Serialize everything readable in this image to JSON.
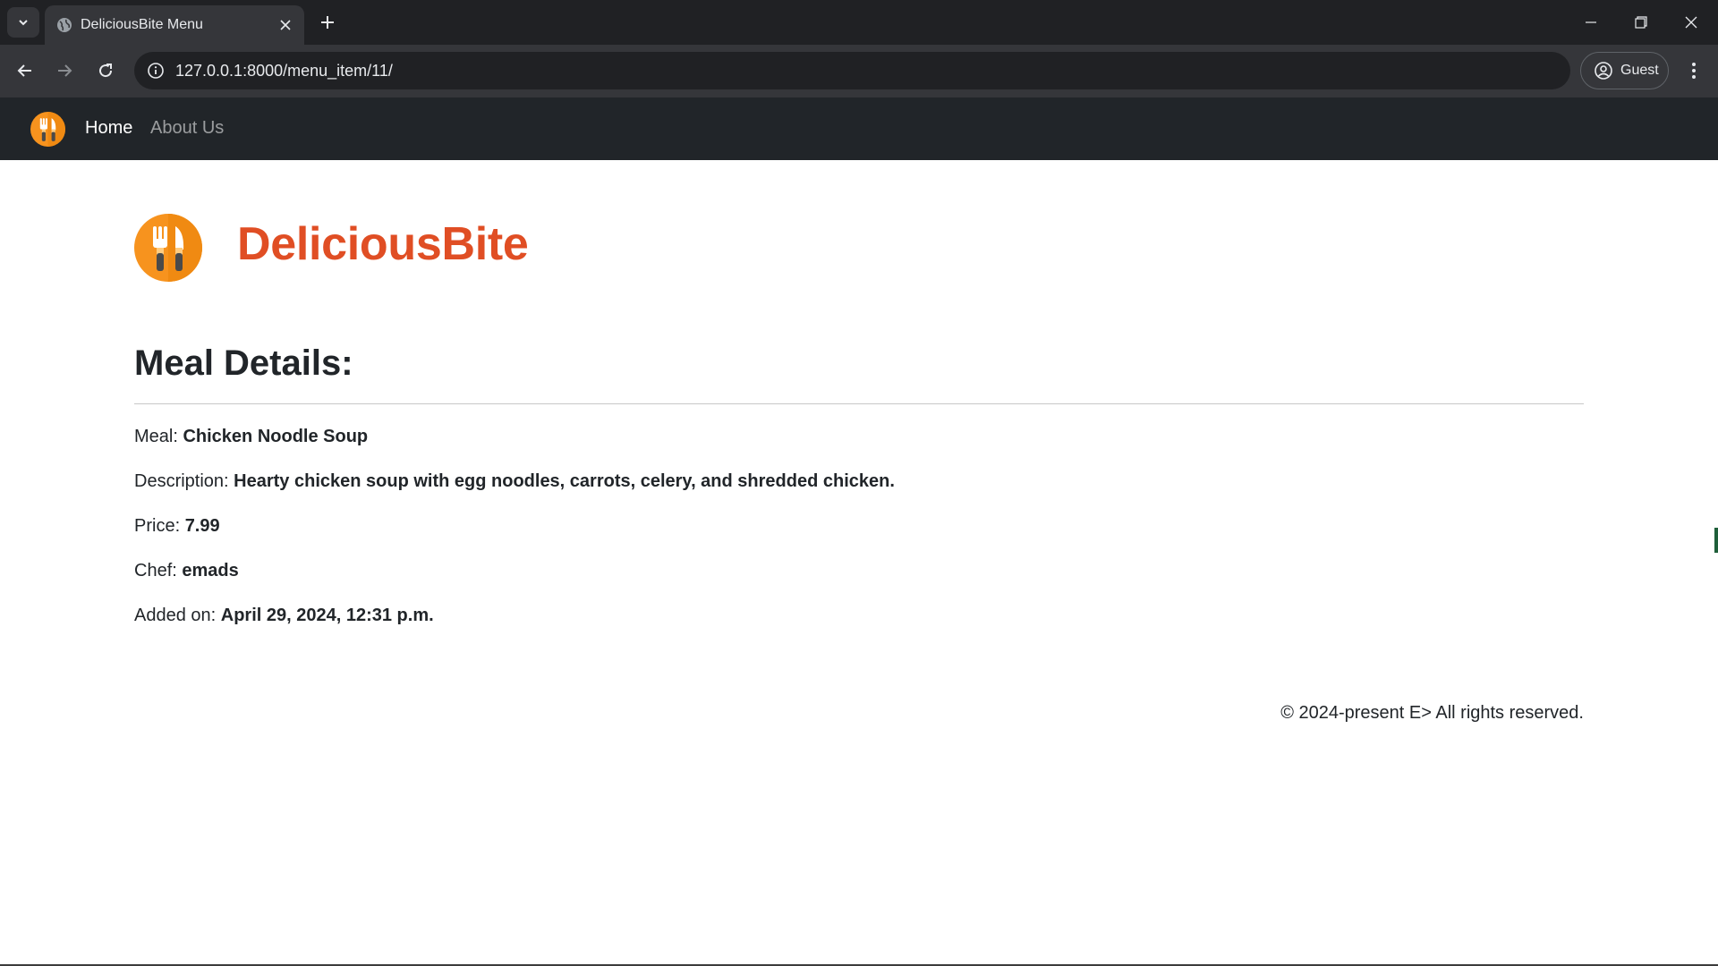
{
  "browser": {
    "tab_title": "DeliciousBite Menu",
    "url": "127.0.0.1:8000/menu_item/11/",
    "profile_label": "Guest"
  },
  "navbar": {
    "links": [
      {
        "label": "Home"
      },
      {
        "label": "About Us"
      }
    ]
  },
  "brand": {
    "name": "DeliciousBite",
    "color": "#e04e24",
    "logo_icon": "fork-knife-icon"
  },
  "page": {
    "section_title": "Meal Details:",
    "details": [
      {
        "label": "Meal:",
        "value": "Chicken Noodle Soup"
      },
      {
        "label": "Description:",
        "value": "Hearty chicken soup with egg noodles, carrots, celery, and shredded chicken."
      },
      {
        "label": "Price:",
        "value": "7.99"
      },
      {
        "label": "Chef:",
        "value": "emads"
      },
      {
        "label": "Added on:",
        "value": "April 29, 2024, 12:31 p.m."
      }
    ],
    "footer": "© 2024-present E> All rights reserved."
  },
  "colors": {
    "navbar_bg": "#212529",
    "logo_orange": "#f7931e",
    "browser_chrome": "#35363a"
  }
}
